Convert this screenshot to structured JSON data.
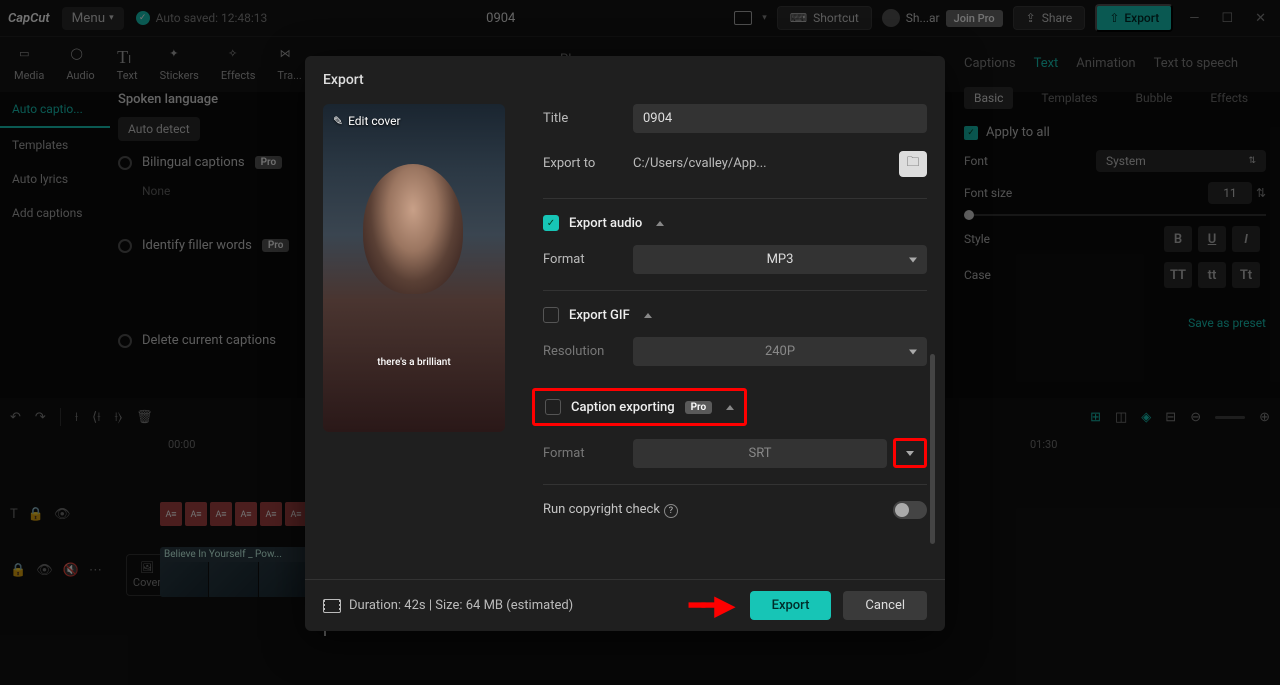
{
  "app": {
    "name": "CapCut",
    "menu": "Menu",
    "autosave": "Auto saved: 12:48:13",
    "project_name": "0904"
  },
  "topbar": {
    "shortcut": "Shortcut",
    "user": "Sh...ar",
    "join_pro": "Join Pro",
    "share": "Share",
    "export": "Export"
  },
  "tools": [
    "Media",
    "Audio",
    "Text",
    "Stickers",
    "Effects",
    "Tra..."
  ],
  "player_label": "Player",
  "sidebar": {
    "tabs": [
      "Auto captio...",
      "Templates",
      "Auto lyrics",
      "Add captions"
    ]
  },
  "left": {
    "spoken_language": "Spoken language",
    "auto_detect": "Auto detect",
    "bilingual": "Bilingual captions",
    "none": "None",
    "identify": "Identify filler words",
    "delete_current": "Delete current captions"
  },
  "right": {
    "tabs": [
      "Captions",
      "Text",
      "Animation",
      "Text to speech"
    ],
    "subtabs": [
      "Basic",
      "Templates",
      "Bubble",
      "Effects"
    ],
    "apply_all": "Apply to all",
    "font": "Font",
    "font_val": "System",
    "font_size": "Font size",
    "font_size_val": "11",
    "style": "Style",
    "case": "Case",
    "case_opts": [
      "TT",
      "tt",
      "Tt"
    ],
    "save_preset": "Save as preset"
  },
  "timeline": {
    "ruler": [
      "00:00",
      "01:30"
    ],
    "clip_title": "Believe In Yourself _ Pow...",
    "cover": "Cover"
  },
  "modal": {
    "title": "Export",
    "title_label": "Title",
    "title_val": "0904",
    "export_to": "Export to",
    "path_val": "C:/Users/cvalley/App...",
    "export_audio": "Export audio",
    "format": "Format",
    "audio_format": "MP3",
    "export_gif": "Export GIF",
    "resolution": "Resolution",
    "gif_res": "240P",
    "caption_exporting": "Caption exporting",
    "caption_format": "SRT",
    "run_copyright": "Run copyright check",
    "cover_edit": "Edit cover",
    "cover_caption": "there's a brilliant",
    "duration": "Duration: 42s | Size: 64 MB (estimated)",
    "export_btn": "Export",
    "cancel_btn": "Cancel"
  }
}
